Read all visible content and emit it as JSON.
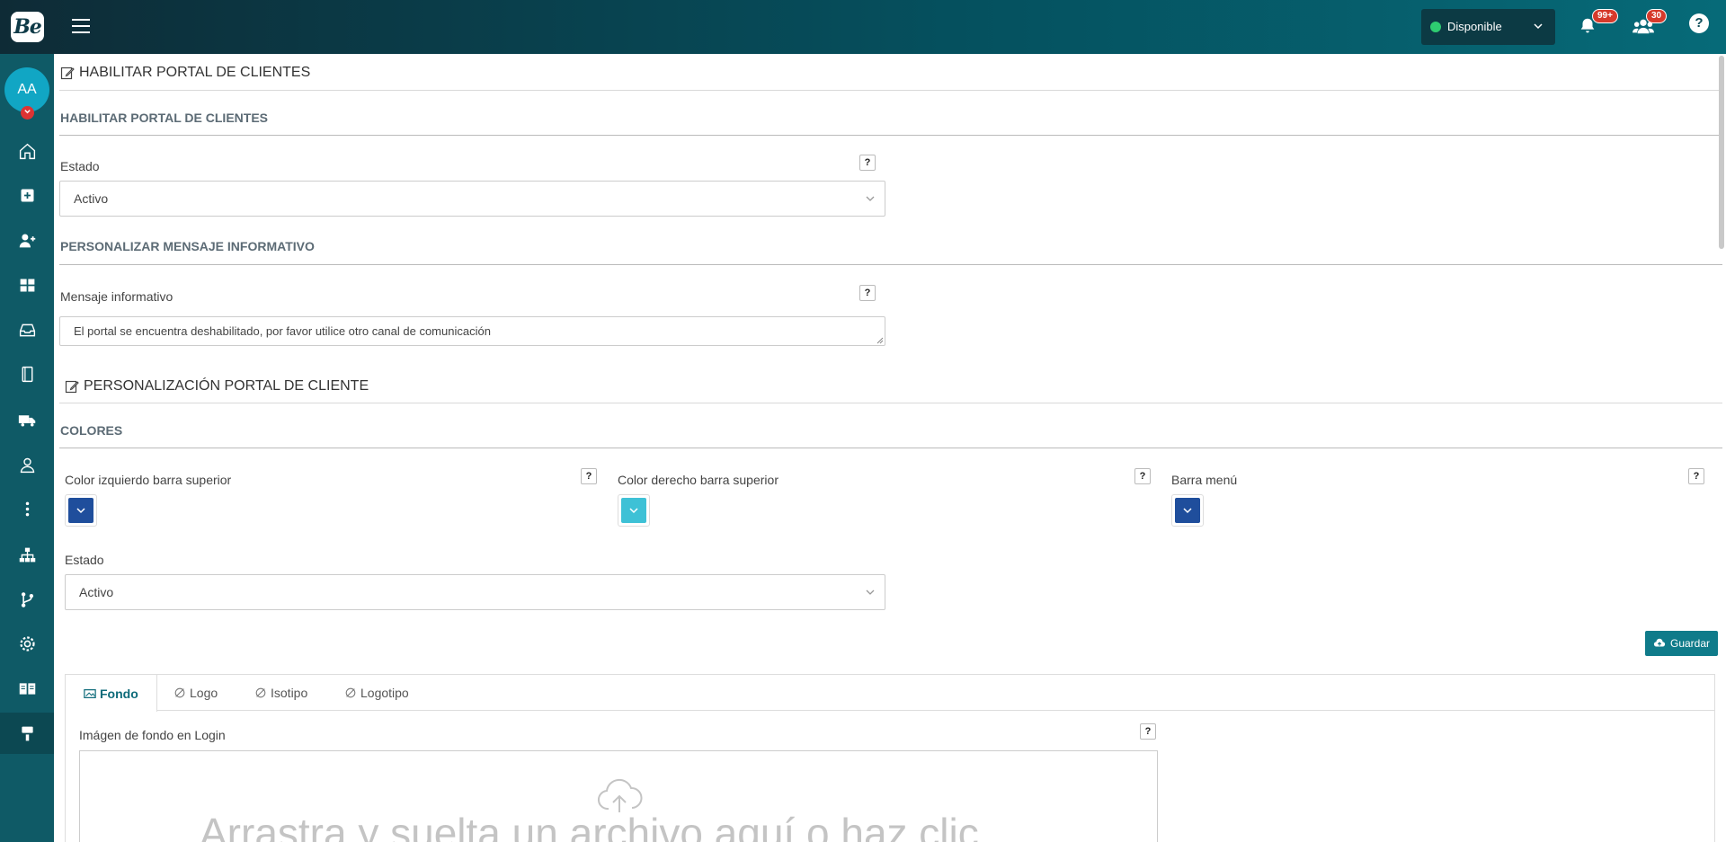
{
  "app": {
    "logo_text": "Be"
  },
  "topbar": {
    "status_label": "Disponible",
    "status_color": "#2ecc71",
    "notifications_badge": "99+",
    "users_badge": "30",
    "help_label": "?"
  },
  "sidebar": {
    "avatar_initials": "AA",
    "items": [
      {
        "icon": "home-icon"
      },
      {
        "icon": "plus-square-icon"
      },
      {
        "icon": "user-plus-icon"
      },
      {
        "icon": "grid-icon"
      },
      {
        "icon": "inbox-icon"
      },
      {
        "icon": "notebook-icon"
      },
      {
        "icon": "truck-icon"
      },
      {
        "icon": "user-icon"
      },
      {
        "icon": "more-vertical-icon"
      },
      {
        "icon": "sitemap-icon"
      },
      {
        "icon": "branch-icon"
      },
      {
        "icon": "gear-icon"
      },
      {
        "icon": "book-icon"
      },
      {
        "icon": "paint-roller-icon"
      }
    ]
  },
  "portal": {
    "title": "HABILITAR PORTAL DE CLIENTES",
    "sub_enable": "HABILITAR PORTAL DE CLIENTES",
    "estado_label": "Estado",
    "estado_value": "Activo",
    "sub_message": "PERSONALIZAR MENSAJE INFORMATIVO",
    "message_label": "Mensaje informativo",
    "message_value": "El portal se encuentra deshabilitado, por favor utilice otro canal de comunicación",
    "help": "?"
  },
  "customization": {
    "title": "PERSONALIZACIÓN PORTAL DE CLIENTE",
    "sub_colors": "COLORES",
    "colors": [
      {
        "label": "Color izquierdo barra superior",
        "value": "#1f4e9c"
      },
      {
        "label": "Color derecho barra superior",
        "value": "#3ec1d6"
      },
      {
        "label": "Barra menú",
        "value": "#1f4e9c"
      }
    ],
    "estado_label": "Estado",
    "estado_value": "Activo",
    "save_label": "Guardar",
    "tabs": [
      {
        "label": "Fondo",
        "active": true
      },
      {
        "label": "Logo",
        "active": false
      },
      {
        "label": "Isotipo",
        "active": false
      },
      {
        "label": "Logotipo",
        "active": false
      }
    ],
    "bg_label": "Imágen de fondo en Login",
    "dropzone_text": "Arrastra y suelta un archivo aquí o haz clic"
  }
}
